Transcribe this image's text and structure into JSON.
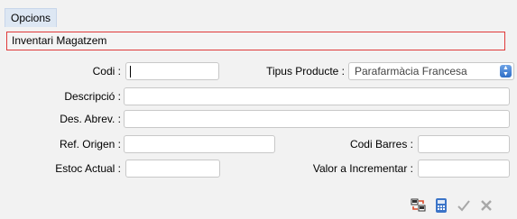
{
  "menu": {
    "item_label": "Opcions"
  },
  "window": {
    "title": "Inventari Magatzem"
  },
  "form": {
    "codi_label": "Codi :",
    "codi_value": "",
    "tipus_label": "Tipus Producte :",
    "tipus_value": "Parafarmàcia Francesa",
    "descripcio_label": "Descripció :",
    "descripcio_value": "",
    "des_abrev_label": "Des. Abrev. :",
    "des_abrev_value": "",
    "ref_origen_label": "Ref. Origen :",
    "ref_origen_value": "",
    "codi_barres_label": "Codi Barres :",
    "codi_barres_value": "",
    "estoc_label": "Estoc Actual :",
    "estoc_value": "",
    "valor_label": "Valor a Incrementar :",
    "valor_value": ""
  },
  "toolbar": {
    "icons": [
      "transfer-icon",
      "calculator-icon",
      "checkmark-icon",
      "close-icon"
    ],
    "accent_blue": "#3b74c8",
    "disabled_gray": "#a8a8a8"
  }
}
